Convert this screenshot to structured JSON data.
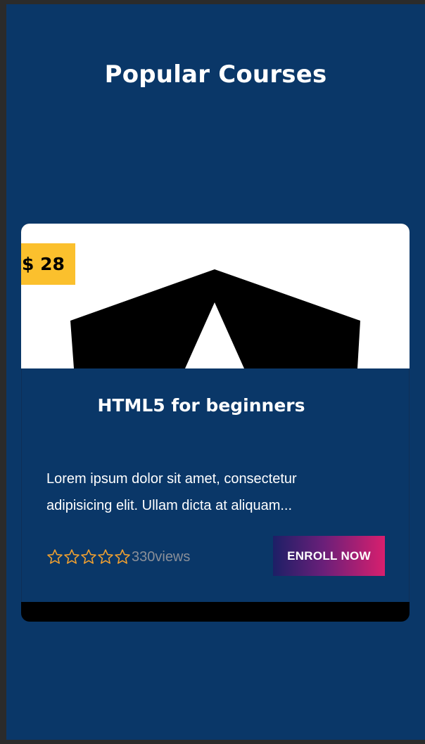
{
  "section": {
    "title": "Popular Courses"
  },
  "course": {
    "price": "$ 28",
    "title": "HTML5 for beginners",
    "description": "Lorem ipsum dolor sit amet, consectetur adipisicing elit. Ullam dicta at aliquam...",
    "rating_stars": 5,
    "views": "330views",
    "enroll_label": "ENROLL NOW",
    "image_icon": "html5-logo-icon"
  },
  "colors": {
    "page_bg": "#0a3768",
    "badge": "#fbc02d",
    "star": "#f0a030",
    "button_gradient_start": "#1d1f66",
    "button_gradient_end": "#d81f6e"
  }
}
